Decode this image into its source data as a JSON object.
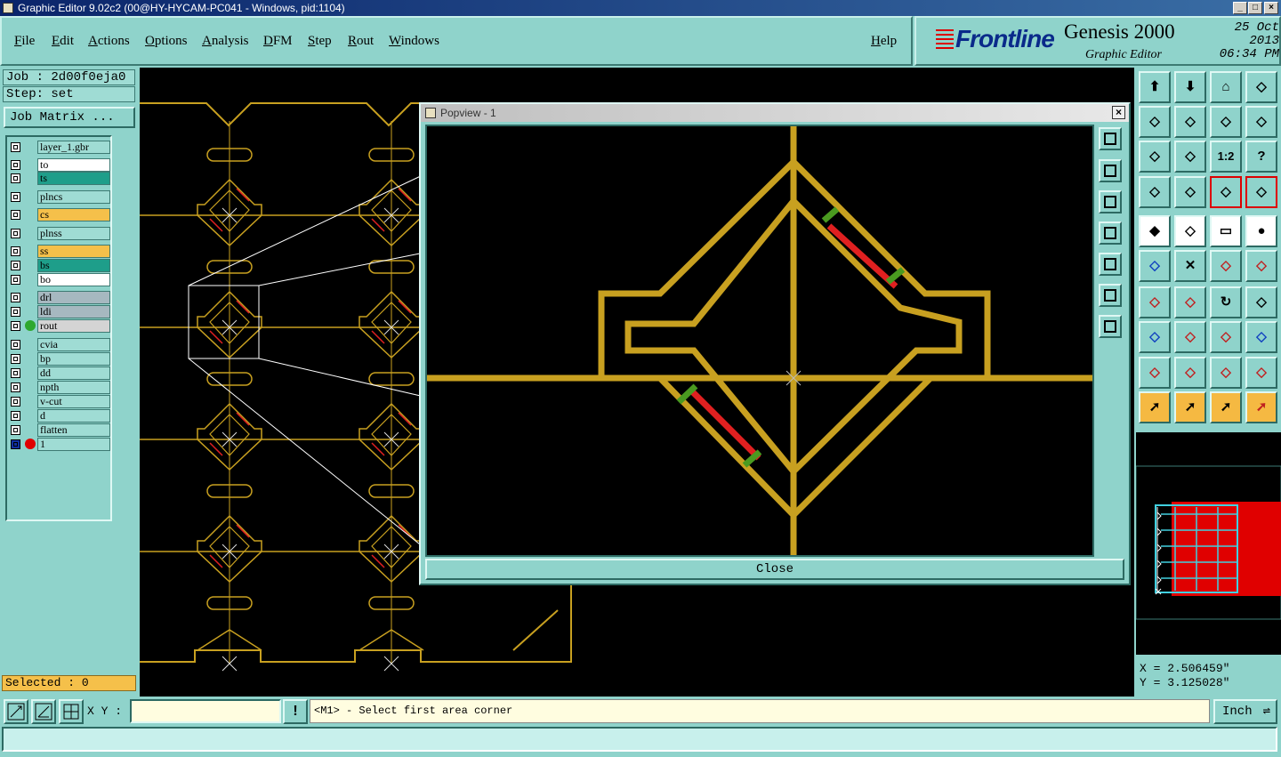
{
  "window": {
    "title": "Graphic Editor 9.02c2 (00@HY-HYCAM-PC041 - Windows, pid:1104)"
  },
  "menubar": {
    "items": [
      "File",
      "Edit",
      "Actions",
      "Options",
      "Analysis",
      "DFM",
      "Step",
      "Rout",
      "Windows"
    ],
    "help": "Help"
  },
  "brand": {
    "logo": "Frontline",
    "product": "Genesis 2000",
    "subtitle": "Graphic Editor",
    "date": "25 Oct 2013",
    "time": "06:34 PM"
  },
  "job": {
    "job": "Job : 2d00f0eja0",
    "step": "Step: set",
    "matrix_button": "Job Matrix ..."
  },
  "layers": [
    {
      "name": "layer_1.gbr",
      "color": "#9fdcd4",
      "dot": ""
    },
    {
      "name": "to",
      "color": "#ffffff",
      "dot": ""
    },
    {
      "name": "ts",
      "color": "#1e9e8a",
      "dot": ""
    },
    {
      "name": "plncs",
      "color": "#9fdcd4",
      "dot": ""
    },
    {
      "name": "cs",
      "color": "#f5c04a",
      "dot": ""
    },
    {
      "name": "plnss",
      "color": "#9fdcd4",
      "dot": ""
    },
    {
      "name": "ss",
      "color": "#f5c04a",
      "dot": ""
    },
    {
      "name": "bs",
      "color": "#1e9e8a",
      "dot": ""
    },
    {
      "name": "bo",
      "color": "#ffffff",
      "dot": ""
    },
    {
      "name": "drl",
      "color": "#a6b8c0",
      "dot": ""
    },
    {
      "name": "ldi",
      "color": "#a6b8c0",
      "dot": ""
    },
    {
      "name": "rout",
      "color": "#d4d4d4",
      "dot": "#2ea82e"
    },
    {
      "name": "cvia",
      "color": "#9fdcd4",
      "dot": ""
    },
    {
      "name": "bp",
      "color": "#9fdcd4",
      "dot": ""
    },
    {
      "name": "dd",
      "color": "#9fdcd4",
      "dot": ""
    },
    {
      "name": "npth",
      "color": "#9fdcd4",
      "dot": ""
    },
    {
      "name": "v-cut",
      "color": "#9fdcd4",
      "dot": ""
    },
    {
      "name": "d",
      "color": "#9fdcd4",
      "dot": ""
    },
    {
      "name": "flatten",
      "color": "#9fdcd4",
      "dot": ""
    },
    {
      "name": "1",
      "color": "#9fdcd4",
      "dot": "#e00000"
    }
  ],
  "selected": "Selected : 0",
  "popview": {
    "title": "Popview - 1",
    "close_label": "Close"
  },
  "tools": {
    "ratio_label": "1:2",
    "help_label": "?"
  },
  "coords": {
    "x": "X = 2.506459\"",
    "y": "Y = 3.125028\""
  },
  "bottom": {
    "xy_label": "X Y :",
    "xy_value": "",
    "warn_label": "!",
    "message": "<M1> - Select first area corner",
    "unit": "Inch"
  },
  "colors": {
    "trace": "#c8a020",
    "pad": "#e02020",
    "mask": "#4a9a20",
    "background": "#000000",
    "panel": "#8fd3cb"
  }
}
